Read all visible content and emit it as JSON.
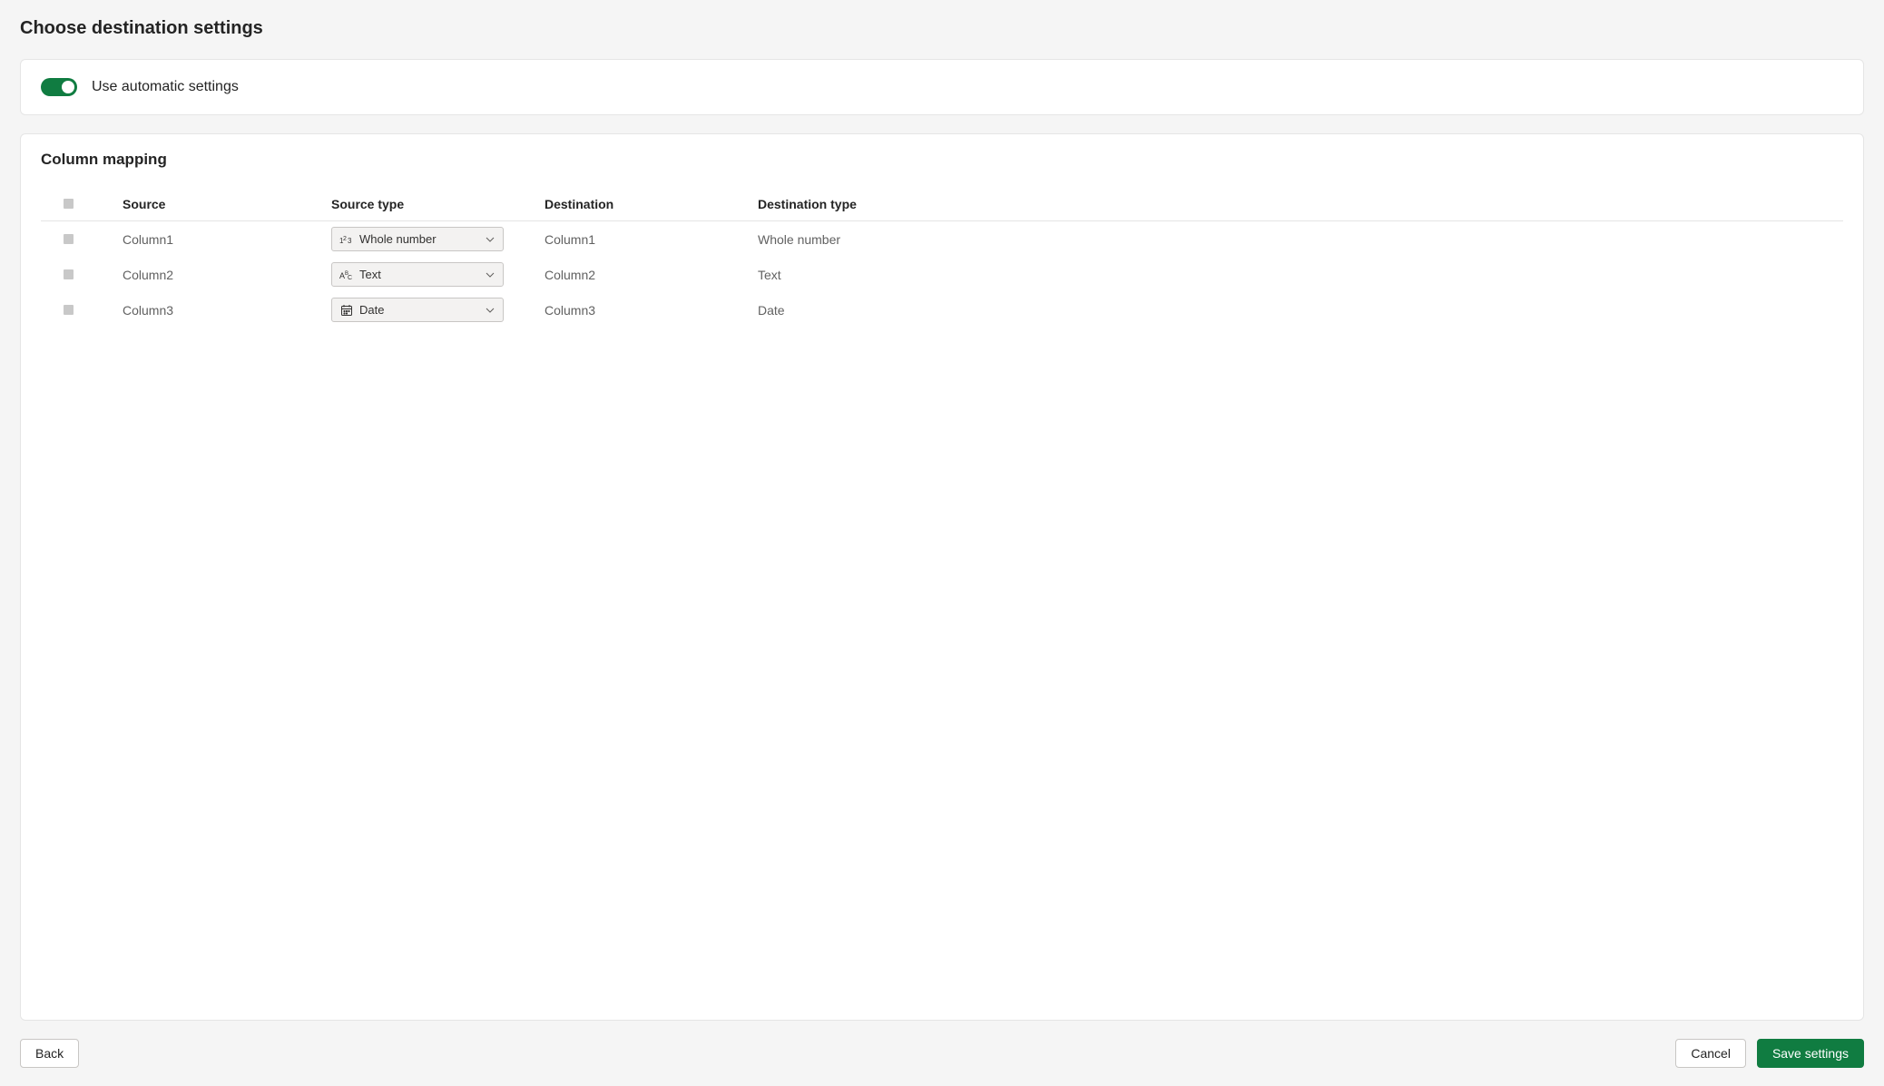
{
  "page": {
    "title": "Choose destination settings"
  },
  "autoSettings": {
    "label": "Use automatic settings"
  },
  "mapping": {
    "title": "Column mapping",
    "headers": {
      "source": "Source",
      "sourceType": "Source type",
      "destination": "Destination",
      "destinationType": "Destination type"
    },
    "rows": [
      {
        "source": "Column1",
        "sourceType": "Whole number",
        "icon": "number",
        "destination": "Column1",
        "destinationType": "Whole number"
      },
      {
        "source": "Column2",
        "sourceType": "Text",
        "icon": "text",
        "destination": "Column2",
        "destinationType": "Text"
      },
      {
        "source": "Column3",
        "sourceType": "Date",
        "icon": "date",
        "destination": "Column3",
        "destinationType": "Date"
      }
    ]
  },
  "footer": {
    "back": "Back",
    "cancel": "Cancel",
    "save": "Save settings"
  }
}
